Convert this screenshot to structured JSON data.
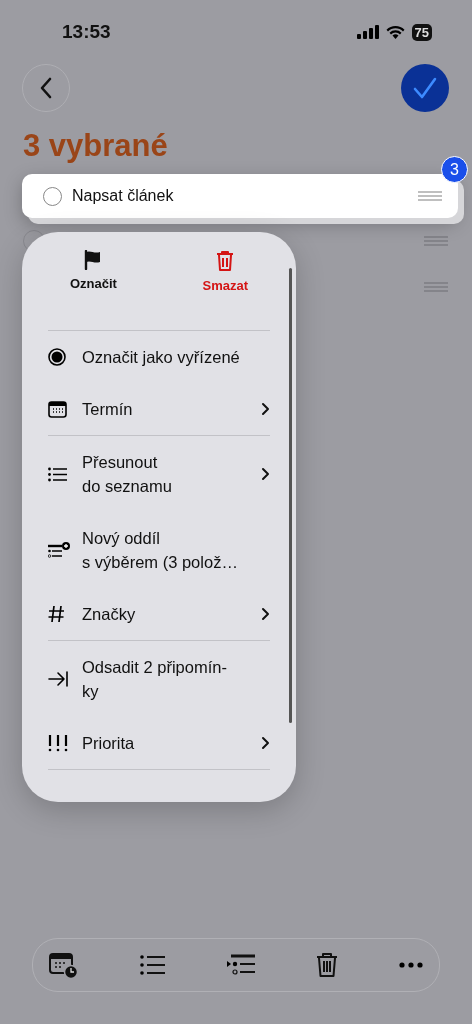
{
  "status_bar": {
    "time": "13:53",
    "battery": "75"
  },
  "title": "3 vybrané",
  "dragged_item": {
    "title": "Napsat článek",
    "completed": false,
    "count_badge": "3"
  },
  "menu": {
    "actions": [
      {
        "label": "Označit",
        "kind": "flag",
        "destructive": false
      },
      {
        "label": "Smazat",
        "kind": "trash",
        "destructive": true
      }
    ],
    "sections": [
      [
        {
          "label": "Označit jako vyřízené",
          "kind": "completed",
          "submenu": false
        },
        {
          "label": "Termín",
          "kind": "calendar",
          "submenu": true
        }
      ],
      [
        {
          "label": "Přesunout\ndo seznamu",
          "kind": "list",
          "submenu": true
        },
        {
          "label": "Nový oddíl\ns výběrem (3 polož…",
          "kind": "new-section",
          "submenu": false
        },
        {
          "label": "Značky",
          "kind": "hash",
          "submenu": true
        }
      ],
      [
        {
          "label": "Odsadit 2 připomín-\nky",
          "kind": "indent",
          "submenu": false
        },
        {
          "label": "Priorita",
          "kind": "priority",
          "submenu": true
        }
      ]
    ]
  }
}
